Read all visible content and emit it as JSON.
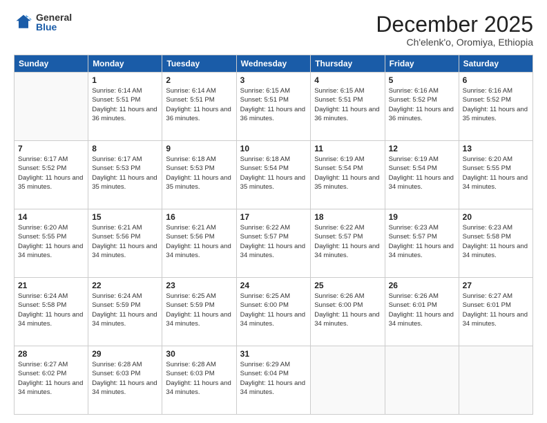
{
  "logo": {
    "general": "General",
    "blue": "Blue"
  },
  "title": "December 2025",
  "subtitle": "Ch'elenk'o, Oromiya, Ethiopia",
  "headers": [
    "Sunday",
    "Monday",
    "Tuesday",
    "Wednesday",
    "Thursday",
    "Friday",
    "Saturday"
  ],
  "weeks": [
    [
      {
        "day": "",
        "sunrise": "",
        "sunset": "",
        "daylight": ""
      },
      {
        "day": "1",
        "sunrise": "Sunrise: 6:14 AM",
        "sunset": "Sunset: 5:51 PM",
        "daylight": "Daylight: 11 hours and 36 minutes."
      },
      {
        "day": "2",
        "sunrise": "Sunrise: 6:14 AM",
        "sunset": "Sunset: 5:51 PM",
        "daylight": "Daylight: 11 hours and 36 minutes."
      },
      {
        "day": "3",
        "sunrise": "Sunrise: 6:15 AM",
        "sunset": "Sunset: 5:51 PM",
        "daylight": "Daylight: 11 hours and 36 minutes."
      },
      {
        "day": "4",
        "sunrise": "Sunrise: 6:15 AM",
        "sunset": "Sunset: 5:51 PM",
        "daylight": "Daylight: 11 hours and 36 minutes."
      },
      {
        "day": "5",
        "sunrise": "Sunrise: 6:16 AM",
        "sunset": "Sunset: 5:52 PM",
        "daylight": "Daylight: 11 hours and 36 minutes."
      },
      {
        "day": "6",
        "sunrise": "Sunrise: 6:16 AM",
        "sunset": "Sunset: 5:52 PM",
        "daylight": "Daylight: 11 hours and 35 minutes."
      }
    ],
    [
      {
        "day": "7",
        "sunrise": "Sunrise: 6:17 AM",
        "sunset": "Sunset: 5:52 PM",
        "daylight": "Daylight: 11 hours and 35 minutes."
      },
      {
        "day": "8",
        "sunrise": "Sunrise: 6:17 AM",
        "sunset": "Sunset: 5:53 PM",
        "daylight": "Daylight: 11 hours and 35 minutes."
      },
      {
        "day": "9",
        "sunrise": "Sunrise: 6:18 AM",
        "sunset": "Sunset: 5:53 PM",
        "daylight": "Daylight: 11 hours and 35 minutes."
      },
      {
        "day": "10",
        "sunrise": "Sunrise: 6:18 AM",
        "sunset": "Sunset: 5:54 PM",
        "daylight": "Daylight: 11 hours and 35 minutes."
      },
      {
        "day": "11",
        "sunrise": "Sunrise: 6:19 AM",
        "sunset": "Sunset: 5:54 PM",
        "daylight": "Daylight: 11 hours and 35 minutes."
      },
      {
        "day": "12",
        "sunrise": "Sunrise: 6:19 AM",
        "sunset": "Sunset: 5:54 PM",
        "daylight": "Daylight: 11 hours and 34 minutes."
      },
      {
        "day": "13",
        "sunrise": "Sunrise: 6:20 AM",
        "sunset": "Sunset: 5:55 PM",
        "daylight": "Daylight: 11 hours and 34 minutes."
      }
    ],
    [
      {
        "day": "14",
        "sunrise": "Sunrise: 6:20 AM",
        "sunset": "Sunset: 5:55 PM",
        "daylight": "Daylight: 11 hours and 34 minutes."
      },
      {
        "day": "15",
        "sunrise": "Sunrise: 6:21 AM",
        "sunset": "Sunset: 5:56 PM",
        "daylight": "Daylight: 11 hours and 34 minutes."
      },
      {
        "day": "16",
        "sunrise": "Sunrise: 6:21 AM",
        "sunset": "Sunset: 5:56 PM",
        "daylight": "Daylight: 11 hours and 34 minutes."
      },
      {
        "day": "17",
        "sunrise": "Sunrise: 6:22 AM",
        "sunset": "Sunset: 5:57 PM",
        "daylight": "Daylight: 11 hours and 34 minutes."
      },
      {
        "day": "18",
        "sunrise": "Sunrise: 6:22 AM",
        "sunset": "Sunset: 5:57 PM",
        "daylight": "Daylight: 11 hours and 34 minutes."
      },
      {
        "day": "19",
        "sunrise": "Sunrise: 6:23 AM",
        "sunset": "Sunset: 5:57 PM",
        "daylight": "Daylight: 11 hours and 34 minutes."
      },
      {
        "day": "20",
        "sunrise": "Sunrise: 6:23 AM",
        "sunset": "Sunset: 5:58 PM",
        "daylight": "Daylight: 11 hours and 34 minutes."
      }
    ],
    [
      {
        "day": "21",
        "sunrise": "Sunrise: 6:24 AM",
        "sunset": "Sunset: 5:58 PM",
        "daylight": "Daylight: 11 hours and 34 minutes."
      },
      {
        "day": "22",
        "sunrise": "Sunrise: 6:24 AM",
        "sunset": "Sunset: 5:59 PM",
        "daylight": "Daylight: 11 hours and 34 minutes."
      },
      {
        "day": "23",
        "sunrise": "Sunrise: 6:25 AM",
        "sunset": "Sunset: 5:59 PM",
        "daylight": "Daylight: 11 hours and 34 minutes."
      },
      {
        "day": "24",
        "sunrise": "Sunrise: 6:25 AM",
        "sunset": "Sunset: 6:00 PM",
        "daylight": "Daylight: 11 hours and 34 minutes."
      },
      {
        "day": "25",
        "sunrise": "Sunrise: 6:26 AM",
        "sunset": "Sunset: 6:00 PM",
        "daylight": "Daylight: 11 hours and 34 minutes."
      },
      {
        "day": "26",
        "sunrise": "Sunrise: 6:26 AM",
        "sunset": "Sunset: 6:01 PM",
        "daylight": "Daylight: 11 hours and 34 minutes."
      },
      {
        "day": "27",
        "sunrise": "Sunrise: 6:27 AM",
        "sunset": "Sunset: 6:01 PM",
        "daylight": "Daylight: 11 hours and 34 minutes."
      }
    ],
    [
      {
        "day": "28",
        "sunrise": "Sunrise: 6:27 AM",
        "sunset": "Sunset: 6:02 PM",
        "daylight": "Daylight: 11 hours and 34 minutes."
      },
      {
        "day": "29",
        "sunrise": "Sunrise: 6:28 AM",
        "sunset": "Sunset: 6:03 PM",
        "daylight": "Daylight: 11 hours and 34 minutes."
      },
      {
        "day": "30",
        "sunrise": "Sunrise: 6:28 AM",
        "sunset": "Sunset: 6:03 PM",
        "daylight": "Daylight: 11 hours and 34 minutes."
      },
      {
        "day": "31",
        "sunrise": "Sunrise: 6:29 AM",
        "sunset": "Sunset: 6:04 PM",
        "daylight": "Daylight: 11 hours and 34 minutes."
      },
      {
        "day": "",
        "sunrise": "",
        "sunset": "",
        "daylight": ""
      },
      {
        "day": "",
        "sunrise": "",
        "sunset": "",
        "daylight": ""
      },
      {
        "day": "",
        "sunrise": "",
        "sunset": "",
        "daylight": ""
      }
    ]
  ]
}
